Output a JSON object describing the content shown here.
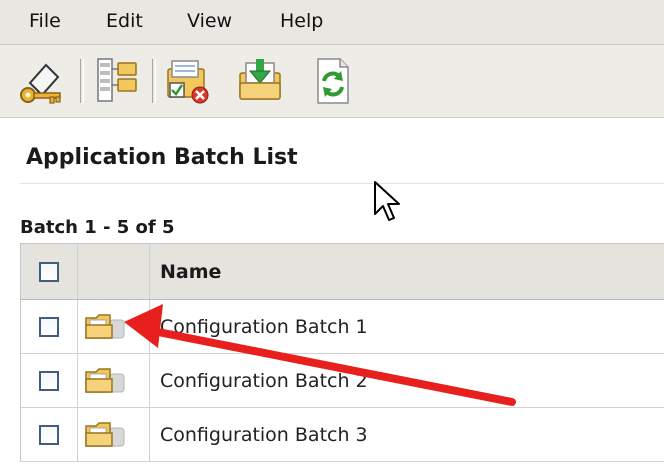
{
  "menubar": {
    "items": [
      {
        "label": "File"
      },
      {
        "label": "Edit"
      },
      {
        "label": "View"
      },
      {
        "label": "Help"
      }
    ]
  },
  "toolbar": {
    "buttons": [
      {
        "icon": "key-icon"
      },
      {
        "icon": "batch-tree-icon"
      },
      {
        "icon": "clear-batch-icon"
      },
      {
        "icon": "import-batch-icon"
      },
      {
        "icon": "refresh-icon"
      }
    ]
  },
  "page": {
    "title": "Application Batch List",
    "batch_count": "Batch 1 - 5 of 5"
  },
  "grid": {
    "header": {
      "name": "Name"
    },
    "rows": [
      {
        "name": "Configuration Batch 1",
        "icon": "folder-icon"
      },
      {
        "name": "Configuration Batch 2",
        "icon": "folder-icon"
      },
      {
        "name": "Configuration Batch 3",
        "icon": "folder-icon"
      }
    ]
  },
  "colors": {
    "menubar_bg": "#e9e7e2",
    "grid_header_bg": "#e5e3de",
    "annotation_arrow": "#e8201d",
    "folder": "#f2c75c"
  }
}
